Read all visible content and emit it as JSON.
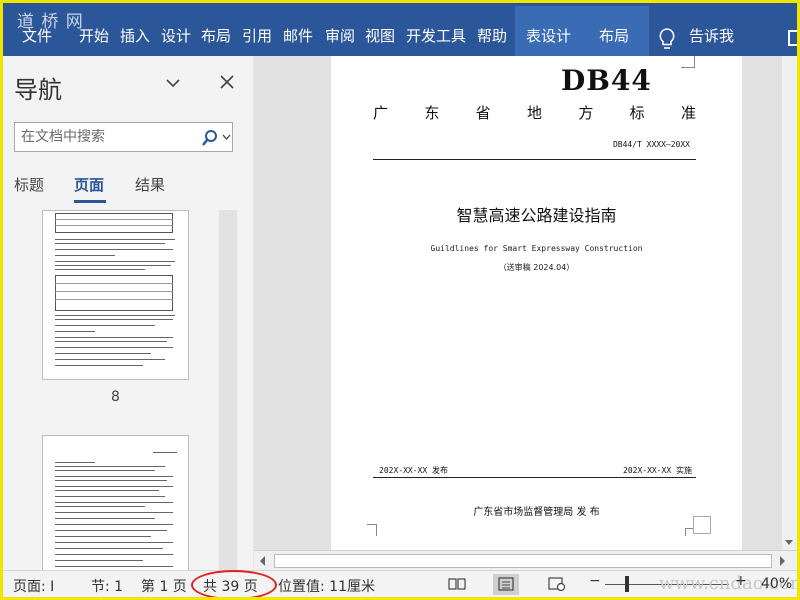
{
  "watermark_logo": "道 桥 网",
  "ribbon": {
    "tabs": [
      "文件",
      "开始",
      "插入",
      "设计",
      "布局",
      "引用",
      "邮件",
      "审阅",
      "视图",
      "开发工具",
      "帮助",
      "表设计",
      "布局",
      "告诉我"
    ]
  },
  "nav": {
    "title": "导航",
    "search_placeholder": "在文档中搜索",
    "tabs": [
      "标题",
      "页面",
      "结果"
    ],
    "active_tab": "页面",
    "thumbnail_page": "8"
  },
  "document": {
    "code": "DB44",
    "province_line": [
      "广",
      "东",
      "省",
      "地",
      "方",
      "标",
      "准"
    ],
    "standard_no": "DB44/T XXXX—20XX",
    "title": "智慧高速公路建设指南",
    "title_en": "Guildlines for Smart Expressway Construction",
    "draft": "（送审稿 2024.04）",
    "publish": "202X-XX-XX  发布",
    "implement": "202X-XX-XX  实施",
    "issuer": "广东省市场监督管理局    发  布"
  },
  "status": {
    "page": "页面: I",
    "section": "节: 1",
    "page_of": "第 1 页",
    "total": "共 39 页",
    "position": "位置值: 11厘米",
    "zoom": "40%",
    "site_watermark": "www.cndao.com"
  }
}
